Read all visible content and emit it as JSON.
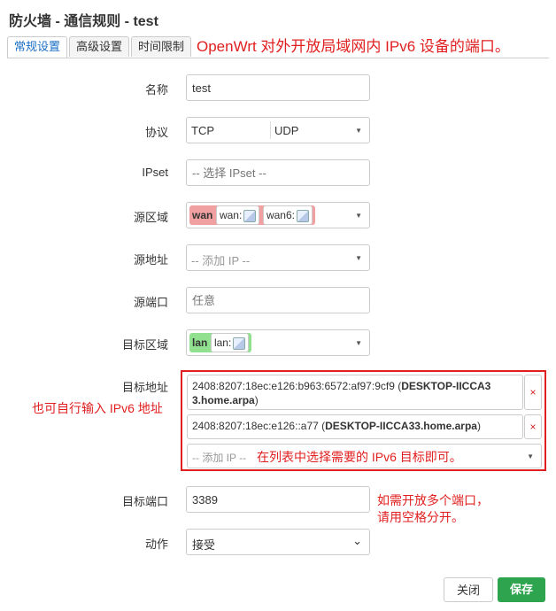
{
  "title": "防火墙 - 通信规则 - test",
  "tabs": [
    "常规设置",
    "高级设置",
    "时间限制"
  ],
  "annotations": {
    "top": "OpenWrt 对外开放局域网内 IPv6 设备的端口。",
    "left": "也可自行输入 IPv6 地址",
    "select_hint": "在列表中选择需要的 IPv6 目标即可。",
    "port_hint_1": "如需开放多个端口，",
    "port_hint_2": "请用空格分开。"
  },
  "form": {
    "name": {
      "label": "名称",
      "value": "test"
    },
    "protocol": {
      "label": "协议",
      "values": [
        "TCP",
        "UDP"
      ]
    },
    "ipset": {
      "label": "IPset",
      "placeholder": "-- 选择 IPset --"
    },
    "src_zone": {
      "label": "源区域",
      "zone": "wan",
      "networks": [
        "wan:",
        "wan6:"
      ],
      "color": "#f0a0a0"
    },
    "src_ip": {
      "label": "源地址",
      "placeholder": "-- 添加 IP --"
    },
    "src_port": {
      "label": "源端口",
      "placeholder": "任意"
    },
    "dest_zone": {
      "label": "目标区域",
      "zone": "lan",
      "networks": [
        "lan:"
      ],
      "color": "#90e090"
    },
    "dest_ip": {
      "label": "目标地址",
      "entries": [
        {
          "addr": "2408:8207:18ec:e126:b963:6572:af97:9cf9 (",
          "host": "DESKTOP-IICCA3",
          "host2": "3.home.arpa",
          "close": ")"
        },
        {
          "addr": "2408:8207:18ec:e126::a77 (",
          "host": "DESKTOP-IICCA33.home.arpa",
          "close": ")"
        }
      ],
      "placeholder": "-- 添加 IP --",
      "remove": "×"
    },
    "dest_port": {
      "label": "目标端口",
      "value": "3389"
    },
    "action": {
      "label": "动作",
      "value": "接受"
    }
  },
  "buttons": {
    "close": "关闭",
    "save": "保存"
  },
  "colors": {
    "accent": "#1a6ec6",
    "annotation": "#e02020",
    "save": "#2ea44f"
  }
}
